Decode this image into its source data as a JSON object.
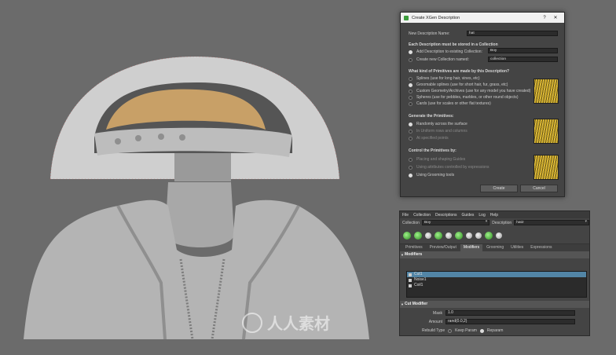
{
  "dialog": {
    "title": "Create XGen Description",
    "help_btn": "?",
    "close_btn": "✕",
    "name_label": "New Description Name:",
    "name_value": "hat",
    "collection_header": "Each Description must be stored in a Collection",
    "add_existing_label": "Add Description to existing Collection:",
    "existing_value": "Boy",
    "create_new_label": "Create new Collection named:",
    "new_collection_placeholder": "collection",
    "primitives_header": "What kind of Primitives are made by this Description?",
    "primitive_options": [
      "Splines (use for long hair, vines, etc)",
      "Groomable splines (use for short hair, fur, grass, etc)",
      "Custom Geometry/Archives (use for any model you have created)",
      "Spheres (use for pebbles, marbles, or other round objects)",
      "Cards (use for scales or other flat textures)"
    ],
    "generate_header": "Generate the Primitives:",
    "generate_options": [
      "Randomly across the surface",
      "In Uniform rows and columns",
      "At specified points"
    ],
    "control_header": "Control the Primitives by:",
    "control_options": [
      "Placing and shaping Guides",
      "Using attributes controlled by expressions",
      "Using Grooming tools"
    ],
    "create_btn": "Create",
    "cancel_btn": "Cancel"
  },
  "panel": {
    "menu": [
      "File",
      "Collection",
      "Descriptions",
      "Guides",
      "Log",
      "Help"
    ],
    "collection_label": "Collection",
    "collection_value": "Boy",
    "description_label": "Description",
    "description_value": "hat2",
    "tabs": [
      "Primitives",
      "Preview/Output",
      "Modifiers",
      "Grooming",
      "Utilities",
      "Expressions"
    ],
    "modifiers_header": "Modifiers",
    "modifiers": [
      "Cut1",
      "Noise1",
      "Coil1"
    ],
    "cut_header": "Cut Modifier",
    "mask_label": "Mask",
    "mask_value": "1.0",
    "amount_label": "Amount",
    "amount_value": "rand(0.0,2)",
    "rebuild_label": "Rebuild Type",
    "rebuild_opt1": "Keep Param",
    "rebuild_opt2": "Reparam"
  },
  "watermark": "人人素材"
}
